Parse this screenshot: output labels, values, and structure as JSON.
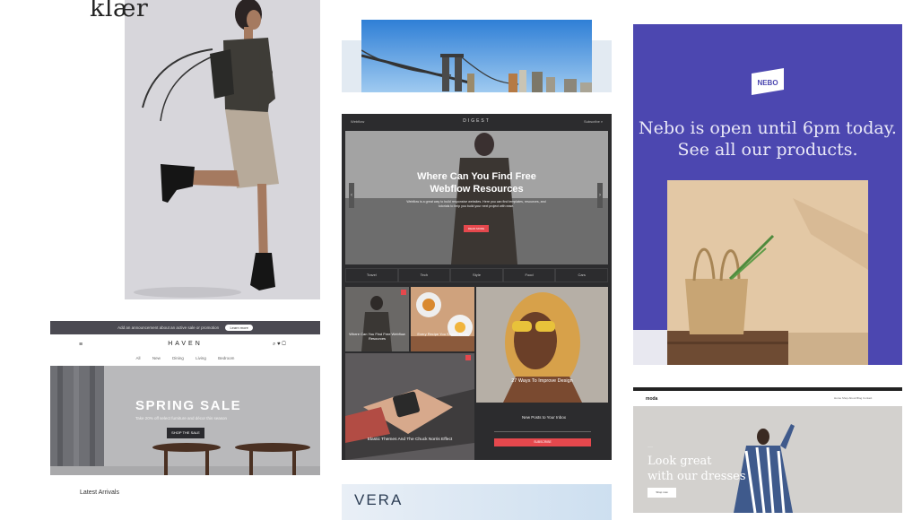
{
  "klaer": {
    "logo": "klær"
  },
  "haven": {
    "announcement": "Add an announcement about an active sale or promotion",
    "announcement_button": "Learn more",
    "menu_icon": "≡",
    "brand": "HAVEN",
    "header_icons": "⌕ ♥ ▢",
    "nav": [
      "All",
      "New",
      "Dining",
      "Living",
      "Bedroom"
    ],
    "hero_title": "SPRING SALE",
    "hero_subtitle": "Take 20% off select furniture and décor this season",
    "hero_button": "SHOP THE SALE",
    "latest": "Latest Arrivals"
  },
  "digest": {
    "header_left": "Webflow",
    "title": "DIGEST",
    "header_right": "Subscribe ⌕",
    "hero_title_line1": "Where Can You Find Free",
    "hero_title_line2": "Webflow Resources",
    "hero_text": "Webflow is a great way to build responsive websites. Here you can find templates, resources, and tutorials to help you build your next project with ease.",
    "hero_button": "READ MORE",
    "arrow_left": "‹",
    "arrow_right": "›",
    "categories": [
      "Travel",
      "Tech",
      "Style",
      "Food",
      "Cars"
    ],
    "tile1_caption": "Where Can You Find Free Webflow Resources",
    "tile2_caption": "Every Recipe You Should Know",
    "tile3_caption": "27 Ways To Improve Design",
    "tile4_caption": "Elastic Themes And The Chuck Norris Effect",
    "newsletter_title": "New Posts to Your Inbox",
    "newsletter_button": "SUBSCRIBE"
  },
  "vera": {
    "title": "VERA"
  },
  "nebo": {
    "logo": "NEBO",
    "message_line1": "Nebo is open until 6pm today.",
    "message_line2": "See all our products."
  },
  "moda": {
    "brand": "moda",
    "nav": "Home   Shop   About   Blog   Contact",
    "kicker": "——",
    "headline_line1": "Look great",
    "headline_line2": "with our dresses",
    "button": "Shop now"
  },
  "colors": {
    "nebo_bg": "#4c47b0",
    "digest_bg": "#2c2c2e",
    "accent_red": "#e5484d",
    "haven_dark": "#2a2a2e"
  }
}
